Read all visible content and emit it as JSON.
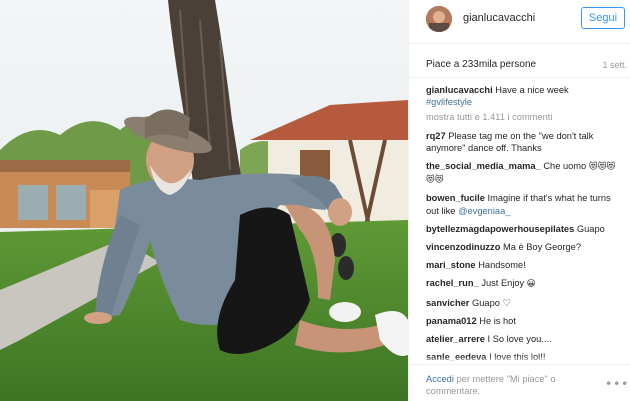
{
  "header": {
    "username": "gianlucavacchi",
    "follow_label": "Segui"
  },
  "likes": {
    "text": "Piace a 233mila persone",
    "time": "1 sett."
  },
  "caption": {
    "user": "gianlucavacchi",
    "text": "Have a nice week",
    "hashtag": "#gvlifestyle"
  },
  "load_more": "mostra tutti e 1.411 i commenti",
  "comments": [
    {
      "user": "rq27",
      "text": "Please tag me on the \"we don't talk anymore\" dance off. Thanks"
    },
    {
      "user": "the_social_media_mama_",
      "text": "Che uomo",
      "emoji": "😻😻😻😻😻"
    },
    {
      "user": "bowen_fucile",
      "text": "Imagine if that's what he turns out like",
      "mention": "@evgeniaa_"
    },
    {
      "user": "bytellezmagdapowerhousepilates",
      "text": "Guapo"
    },
    {
      "user": "vincenzodinuzzo",
      "text": "Ma è Boy George?"
    },
    {
      "user": "mari_stone",
      "text": "Handsome!"
    },
    {
      "user": "rachel_run_",
      "text": "Just Enjoy",
      "emoji": "😀"
    },
    {
      "user": "sanvicher",
      "text": "Guapo ♡"
    },
    {
      "user": "panama012",
      "text": "He is hot"
    },
    {
      "user": "atelier_arrere",
      "text": "I So love you...."
    },
    {
      "user": "sanle_eedeva",
      "text": "I love this lol!!"
    }
  ],
  "footer": {
    "login_link": "Accedi",
    "login_text": "per mettere \"Mi piace\" o commentare.",
    "more_icon": "more-options-icon"
  },
  "colors": {
    "link": "#3f729b",
    "follow": "#3897f0",
    "muted": "#999999"
  }
}
